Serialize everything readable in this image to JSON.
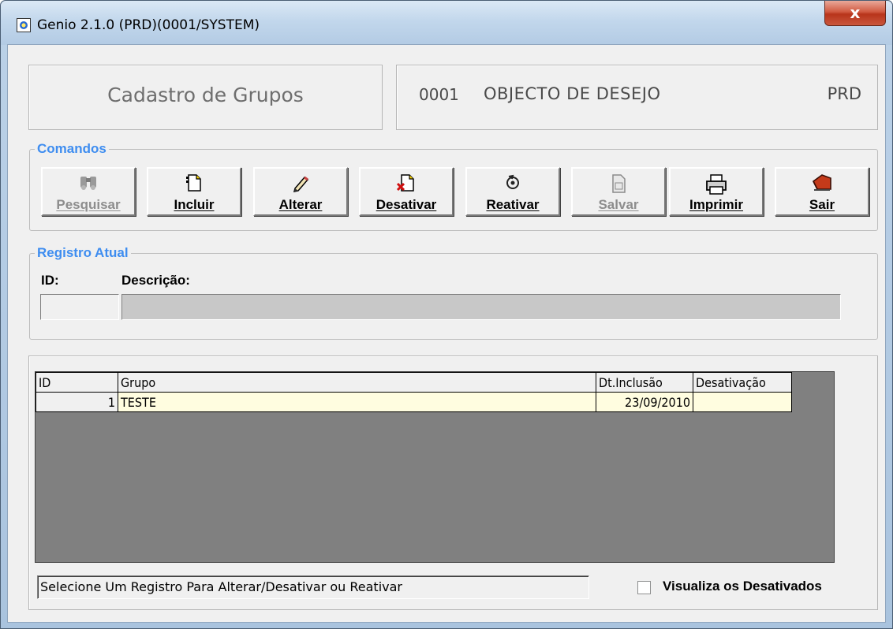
{
  "window": {
    "title": "Genio 2.1.0 (PRD)(0001/SYSTEM)",
    "close_label": "x"
  },
  "header": {
    "form_title": "Cadastro de Grupos",
    "company_code": "0001",
    "company_name": "OBJECTO DE DESEJO",
    "environment": "PRD"
  },
  "commands": {
    "group_label": "Comandos",
    "buttons": [
      {
        "label": "Pesquisar",
        "icon": "binoculars-icon",
        "enabled": false
      },
      {
        "label": "Incluir",
        "icon": "new-document-icon",
        "enabled": true
      },
      {
        "label": "Alterar",
        "icon": "pencil-icon",
        "enabled": true
      },
      {
        "label": "Desativar",
        "icon": "delete-document-icon",
        "enabled": true
      },
      {
        "label": "Reativar",
        "icon": "reactivate-icon",
        "enabled": true
      },
      {
        "label": "Salvar",
        "icon": "save-icon",
        "enabled": false
      },
      {
        "label": "Imprimir",
        "icon": "printer-icon",
        "enabled": true
      },
      {
        "label": "Sair",
        "icon": "exit-icon",
        "enabled": true
      }
    ]
  },
  "record": {
    "group_label": "Registro Atual",
    "id_label": "ID:",
    "description_label": "Descrição:",
    "id_value": "",
    "description_value": ""
  },
  "grid": {
    "columns": [
      "ID",
      "Grupo",
      "Dt.Inclusão",
      "Desativação"
    ],
    "rows": [
      {
        "id": "1",
        "grupo": "TESTE",
        "dt_inclusao": "23/09/2010",
        "desativacao": ""
      }
    ]
  },
  "status": {
    "message": "Selecione Um Registro Para Alterar/Desativar ou Reativar"
  },
  "options": {
    "show_deactivated_label": "Visualiza os Desativados",
    "show_deactivated_checked": false
  },
  "colors": {
    "accent_label": "#3e8df0",
    "grid_background": "#808080",
    "selected_row": "#fffde0"
  }
}
